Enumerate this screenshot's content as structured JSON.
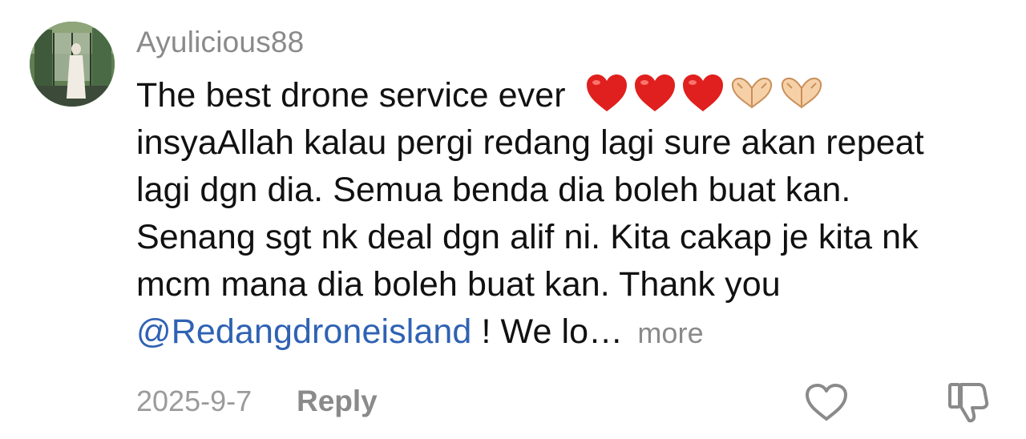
{
  "comment": {
    "username": "Ayulicious88",
    "lines": [
      "The best drone service ever",
      "insyaAllah kalau pergi redang lagi sure akan repeat",
      "lagi dgn dia. Semua benda dia boleh buat kan.",
      "Senang sgt nk deal dgn alif ni. Kita cakap je kita nk",
      "mcm mana dia boleh buat kan. Thank you"
    ],
    "emojis": [
      "red-heart",
      "red-heart",
      "red-heart",
      "heart-hands",
      "heart-hands"
    ],
    "mention": "@Redangdroneisland",
    "tail_text": " ! We lo…",
    "more_label": "more",
    "date": "2025-9-7",
    "reply_label": "Reply"
  },
  "colors": {
    "username": "#8a8a8a",
    "text": "#111111",
    "mention": "#2f62b3",
    "meta": "#9b9b9b",
    "heart": "#e0201e"
  },
  "icons": {
    "like": "heart-outline-icon",
    "dislike": "thumbs-down-icon"
  }
}
